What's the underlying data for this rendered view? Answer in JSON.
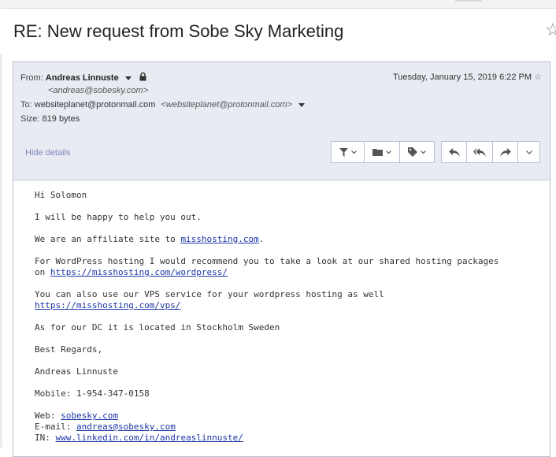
{
  "subject": "RE: New request from Sobe Sky Marketing",
  "header": {
    "from_label": "From:",
    "from_name": "Andreas Linnuste",
    "from_email": "<andreas@sobesky.com>",
    "to_label": "To:",
    "to_address": "websiteplanet@protonmail.com",
    "to_email": "<websiteplanet@protonmail.com>",
    "size_label": "Size:",
    "size_value": "819 bytes",
    "date": "Tuesday, January 15, 2019 6:22 PM",
    "hide_details": "Hide details"
  },
  "toolbar": {
    "icons": [
      "filter-icon",
      "folder-icon",
      "tag-icon",
      "reply-icon",
      "reply-all-icon",
      "forward-icon",
      "more-icon"
    ]
  },
  "body": {
    "greeting": "Hi Solomon",
    "line_help": "I will be happy to help you out.",
    "affiliate_prefix": "We are an affiliate site to ",
    "affiliate_link": "misshosting.com",
    "affiliate_suffix": ".",
    "wordpress_line1": "For WordPress hosting I would recommend you to take a look at our shared hosting packages",
    "wordpress_prefix": "on ",
    "wordpress_link": "https://misshosting.com/wordpress/",
    "vps_line1": "You can also use our VPS service for your wordpress hosting as well",
    "vps_link": "https://misshosting.com/vps/",
    "dc_line": "As for our DC it is located in Stockholm Sweden",
    "regards": "Best Regards,",
    "signature_name": "Andreas Linnuste",
    "mobile": "Mobile: 1-954-347-0158",
    "web_label": "Web: ",
    "web_link": "sobesky.com",
    "email_label": "E-mail: ",
    "email_link": "andreas@sobesky.com",
    "in_label": "IN: ",
    "in_link": "www.linkedin.com/in/andreaslinnuste/"
  }
}
